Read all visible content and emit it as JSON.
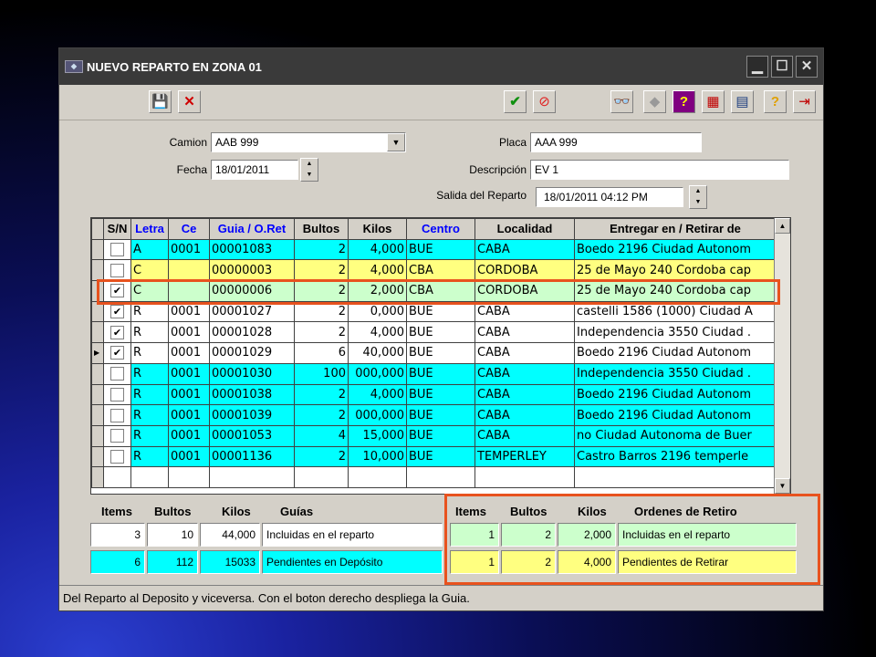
{
  "window": {
    "title": "NUEVO REPARTO EN ZONA 01"
  },
  "colors": {
    "cyan": "#00ffff",
    "yellow": "#ffff80",
    "green": "#ccffcc",
    "white": "#ffffff",
    "highlight": "#e8521e"
  },
  "form": {
    "camion_label": "Camion",
    "camion_value": "AAB 999",
    "fecha_label": "Fecha",
    "fecha_value": "18/01/2011",
    "placa_label": "Placa",
    "placa_value": "AAA 999",
    "descripcion_label": "Descripción",
    "descripcion_value": "EV 1",
    "salida_label": "Salida del Reparto",
    "salida_value": "18/01/2011 04:12 PM"
  },
  "grid": {
    "columns": [
      "S/N",
      "Letra",
      "Ce",
      "Guia / O.Ret",
      "Bultos",
      "Kilos",
      "Centro",
      "Localidad",
      "Entregar en / Retirar de"
    ],
    "rows": [
      {
        "checked": false,
        "letra": "A",
        "ce": "0001",
        "guia": "00001083",
        "bultos": "2",
        "kilos": "4,000",
        "centro": "BUE",
        "localidad": "CABA",
        "destino": "Boedo 2196 Ciudad Autonom",
        "color": "cyan",
        "current": false
      },
      {
        "checked": false,
        "letra": "C",
        "ce": "",
        "guia": "00000003",
        "bultos": "2",
        "kilos": "4,000",
        "centro": "CBA",
        "localidad": "CORDOBA",
        "destino": "25 de Mayo 240 Cordoba cap",
        "color": "yellow",
        "current": false
      },
      {
        "checked": true,
        "letra": "C",
        "ce": "",
        "guia": "00000006",
        "bultos": "2",
        "kilos": "2,000",
        "centro": "CBA",
        "localidad": "CORDOBA",
        "destino": "25 de Mayo 240 Cordoba cap",
        "color": "green",
        "current": false
      },
      {
        "checked": true,
        "letra": "R",
        "ce": "0001",
        "guia": "00001027",
        "bultos": "2",
        "kilos": "0,000",
        "centro": "BUE",
        "localidad": "CABA",
        "destino": "castelli 1586 (1000) Ciudad A",
        "color": "white",
        "current": false
      },
      {
        "checked": true,
        "letra": "R",
        "ce": "0001",
        "guia": "00001028",
        "bultos": "2",
        "kilos": "4,000",
        "centro": "BUE",
        "localidad": "CABA",
        "destino": "Independencia 3550 Ciudad .",
        "color": "white",
        "current": false
      },
      {
        "checked": true,
        "letra": "R",
        "ce": "0001",
        "guia": "00001029",
        "bultos": "6",
        "kilos": "40,000",
        "centro": "BUE",
        "localidad": "CABA",
        "destino": "Boedo 2196 Ciudad Autonom",
        "color": "white",
        "current": true
      },
      {
        "checked": false,
        "letra": "R",
        "ce": "0001",
        "guia": "00001030",
        "bultos": "100",
        "kilos": "000,000",
        "centro": "BUE",
        "localidad": "CABA",
        "destino": "Independencia 3550 Ciudad .",
        "color": "cyan",
        "current": false
      },
      {
        "checked": false,
        "letra": "R",
        "ce": "0001",
        "guia": "00001038",
        "bultos": "2",
        "kilos": "4,000",
        "centro": "BUE",
        "localidad": "CABA",
        "destino": "Boedo 2196 Ciudad Autonom",
        "color": "cyan",
        "current": false
      },
      {
        "checked": false,
        "letra": "R",
        "ce": "0001",
        "guia": "00001039",
        "bultos": "2",
        "kilos": "000,000",
        "centro": "BUE",
        "localidad": "CABA",
        "destino": "Boedo 2196 Ciudad Autonom",
        "color": "cyan",
        "current": false
      },
      {
        "checked": false,
        "letra": "R",
        "ce": "0001",
        "guia": "00001053",
        "bultos": "4",
        "kilos": "15,000",
        "centro": "BUE",
        "localidad": "CABA",
        "destino": "no Ciudad Autonoma de Buer",
        "color": "cyan",
        "current": false
      },
      {
        "checked": false,
        "letra": "R",
        "ce": "0001",
        "guia": "00001136",
        "bultos": "2",
        "kilos": "10,000",
        "centro": "BUE",
        "localidad": "TEMPERLEY",
        "destino": "Castro Barros 2196 temperle",
        "color": "cyan",
        "current": false
      },
      {
        "checked": null,
        "letra": "",
        "ce": "",
        "guia": "",
        "bultos": "",
        "kilos": "",
        "centro": "",
        "localidad": "",
        "destino": "",
        "color": "white",
        "current": false
      }
    ]
  },
  "summary_guias": {
    "headers": {
      "items": "Items",
      "bultos": "Bultos",
      "kilos": "Kilos",
      "label": "Guías"
    },
    "row1": {
      "items": "3",
      "bultos": "10",
      "kilos": "44,000",
      "label": "Incluidas en el reparto"
    },
    "row2": {
      "items": "6",
      "bultos": "112",
      "kilos": "15033",
      "label": "Pendientes en Depósito"
    }
  },
  "summary_retiro": {
    "headers": {
      "items": "Items",
      "bultos": "Bultos",
      "kilos": "Kilos",
      "label": "Ordenes de Retiro"
    },
    "row1": {
      "items": "1",
      "bultos": "2",
      "kilos": "2,000",
      "label": "Incluidas en el reparto"
    },
    "row2": {
      "items": "1",
      "bultos": "2",
      "kilos": "4,000",
      "label": "Pendientes de Retirar"
    }
  },
  "status": "Del Reparto al Deposito y viceversa. Con el boton derecho despliega la Guia."
}
